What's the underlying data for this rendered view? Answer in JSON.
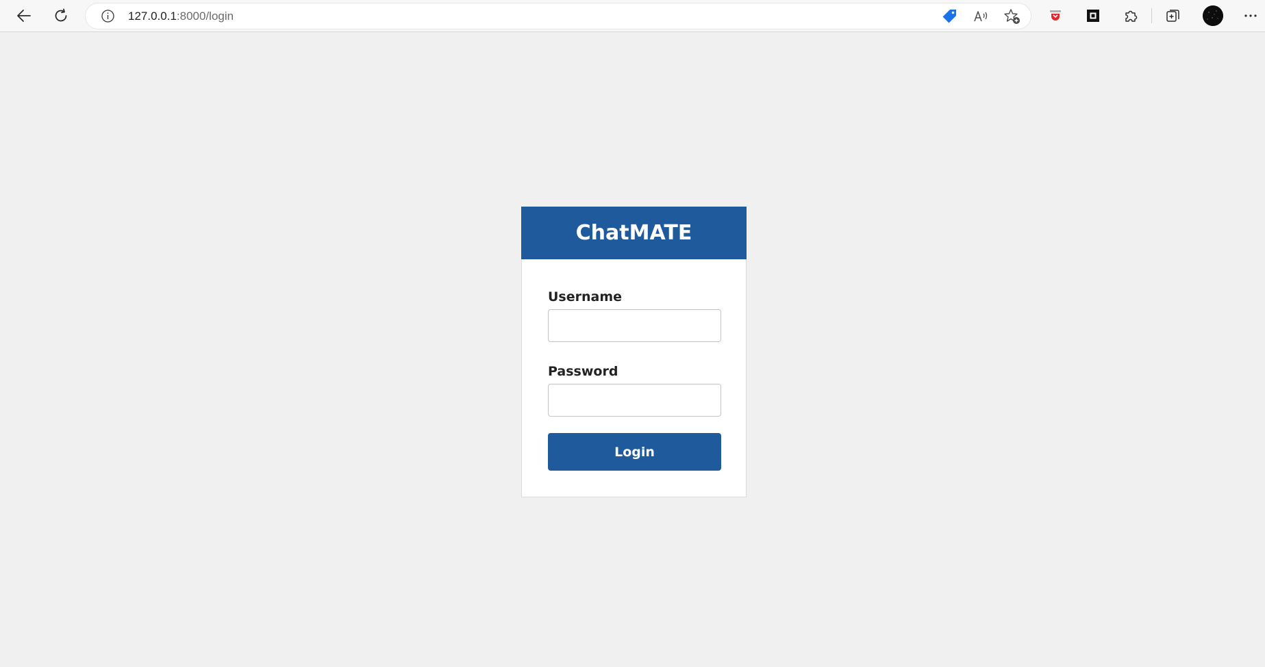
{
  "browser": {
    "url_host": "127.0.0.1",
    "url_path": ":8000/login",
    "icons": {
      "back": "back-arrow-icon",
      "refresh": "refresh-icon",
      "site_info": "info-icon",
      "price_tag": "tag-icon",
      "read_aloud": "read-aloud-icon",
      "favorite": "add-favorite-icon",
      "pocket": "pocket-extension-icon",
      "capture": "screenshot-extension-icon",
      "extensions": "puzzle-icon",
      "collections": "collections-icon",
      "profile": "avatar",
      "menu": "more-icon"
    }
  },
  "login": {
    "title": "ChatMATE",
    "username_label": "Username",
    "username_value": "",
    "password_label": "Password",
    "password_value": "",
    "button_label": "Login"
  },
  "colors": {
    "brand": "#1f5b9c",
    "page_background": "#f0f0f0",
    "card_background": "#ffffff"
  }
}
